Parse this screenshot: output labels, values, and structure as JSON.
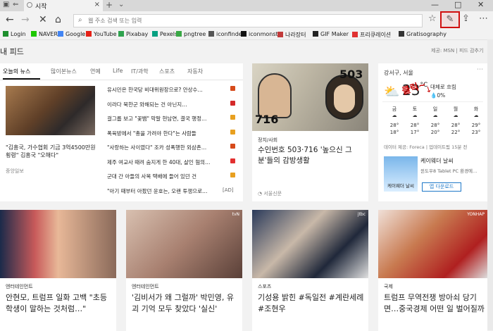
{
  "browser": {
    "tab_title": "시작",
    "new_tab": "+",
    "tab_dropdown": "⌄",
    "address_placeholder": "웹 주소 검색 또는 입력"
  },
  "bookmarks": [
    {
      "label": "Login",
      "color": "#1e8f2e"
    },
    {
      "label": "NAVER",
      "color": "#1ec800"
    },
    {
      "label": "Google",
      "color": "#4285f4"
    },
    {
      "label": "YouTube",
      "color": "#e62117"
    },
    {
      "label": "Pixabay",
      "color": "#2fa34f"
    },
    {
      "label": "Pexels",
      "color": "#05a081"
    },
    {
      "label": "pngtree",
      "color": "#39a845"
    },
    {
      "label": "iconfinder",
      "color": "#555555"
    },
    {
      "label": "iconmonstr",
      "color": "#111111"
    },
    {
      "label": "나라장터",
      "color": "#c23b3b"
    },
    {
      "label": "GIF Maker",
      "color": "#222222"
    },
    {
      "label": "프리큐레이션",
      "color": "#e03030"
    },
    {
      "label": "Gratisography",
      "color": "#333333"
    }
  ],
  "feed": {
    "title": "내 피드",
    "powered": "제공: MSN | 피드 감추기",
    "annotation": "클릭~",
    "annotation_mark": "↓"
  },
  "news": {
    "tabs": [
      "오늘의 뉴스",
      "많이본뉴스",
      "연예",
      "Life",
      "IT/과학",
      "스포츠",
      "자동차"
    ],
    "lead_headline": "\"김흥국, 가수협회 기금 3억4500만원 횡령\" 김흥국 \"오해다\"",
    "lead_source": "중앙일보",
    "items": [
      {
        "text": "유시민은 한국당 비대위원장으로? 안상수…",
        "color": "#d64a1a"
      },
      {
        "text": "이라다 북한군 와해되는 건 아닌지…",
        "color": "#d42a2a"
      },
      {
        "text": "걸그룹 보고 \"꽃뱀\" 막말 현남연, 결국 행정…",
        "color": "#e8a020"
      },
      {
        "text": "폭육방에서 \"총을 가려야 한다\"는 사람들",
        "color": "#e8a020"
      },
      {
        "text": "\"사랑하는 사이였다\" 조카 성폭행한 외삼촌…",
        "color": "#d64a1a"
      },
      {
        "text": "제주 여교사 때려 숨지게 한 40대, 살인 혐의…",
        "color": "#e23030"
      },
      {
        "text": "군대 간 아들의 사복 택배에 들어 있던 건",
        "color": "#e8a020"
      },
      {
        "text": "\"아기 때부터 아팠던 윤호는, 오랜 투쟁으로…",
        "color": "#999999",
        "ad": "[AD]"
      }
    ]
  },
  "story2": {
    "badge": "503",
    "badge2": "716",
    "category": "정치/사회",
    "headline": "수인번호 503·716 '높으신 그분'들의 감방생활",
    "source": "서울신문"
  },
  "weather": {
    "location": "강서구, 서울",
    "temp": "23",
    "unit": "°C",
    "condition": "대체로 흐림",
    "precip": "0%",
    "days": [
      {
        "d": "금",
        "hi": "28°",
        "lo": "18°"
      },
      {
        "d": "토",
        "hi": "28°",
        "lo": "17°"
      },
      {
        "d": "일",
        "hi": "28°",
        "lo": "20°"
      },
      {
        "d": "월",
        "hi": "28°",
        "lo": "22°"
      },
      {
        "d": "화",
        "hi": "29°",
        "lo": "23°"
      }
    ],
    "provider": "데이터 제공: Foreca | 업데이트됨 15분 전",
    "promo_title": "케이웨더 날씨",
    "promo_sub": "윈도우8 Tablet PC 환경에…",
    "promo_img": "케이웨더 날씨",
    "download": "앱 다운로드"
  },
  "bottom": [
    {
      "category": "엔터테인먼트",
      "headline": "안현모, 트럼프 일화 고백 \"초등학생이 말하는 것처럼…\""
    },
    {
      "category": "엔터테인먼트",
      "headline": "'김비서가 왜 그럴까' 박민영, 유괴 기억 모두 찾았다 '실신'",
      "logo": "tvN"
    },
    {
      "category": "스포츠",
      "headline": "기성용 밝힌 #독일전 #계란세례 #조현우",
      "logo": "jtbc"
    },
    {
      "category": "국제",
      "headline": "트럼프 무역전쟁 방아쇠 당기면…중국경제 어떤 일 벌어질까",
      "logo": "YONHAP"
    }
  ]
}
